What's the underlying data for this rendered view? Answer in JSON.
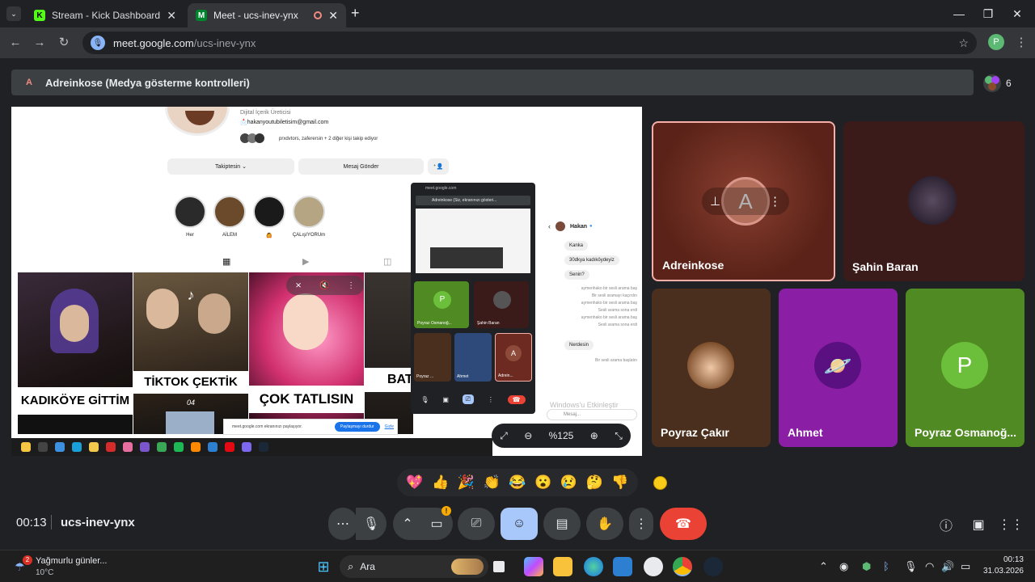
{
  "browser": {
    "tabs": [
      {
        "title": "Stream - Kick Dashboard",
        "favicon": "K",
        "favicon_color": "#53fc18"
      },
      {
        "title": "Meet - ucs-inev-ynx",
        "favicon": "M",
        "favicon_color": "#00832d"
      }
    ],
    "new_tab": "+",
    "url_host": "meet.google.com",
    "url_path": "/ucs-inev-ynx",
    "profile_initial": "P"
  },
  "meet": {
    "presenting_avatar": "A",
    "presenting_label": "Adreinkose (Medya gösterme kontrolleri)",
    "participant_count": "6",
    "time": "00:13",
    "meeting_code": "ucs-inev-ynx",
    "tiles": [
      {
        "name": "Adreinkose",
        "initial": "A",
        "color": "#6d2a20"
      },
      {
        "name": "Şahin Baran",
        "color": "#3b1a1a"
      },
      {
        "name": "Poyraz Çakır",
        "color": "#4a2f1e"
      },
      {
        "name": "Ahmet",
        "color": "#8a1fa6"
      },
      {
        "name": "Poyraz Osmanoğ...",
        "initial": "P",
        "color": "#4f8a22"
      }
    ],
    "reactions": [
      "💖",
      "👍",
      "🎉",
      "👏",
      "😂",
      "😮",
      "😢",
      "🤔",
      "👎"
    ],
    "reaction_skin_tone": "#f9cc19",
    "end_call_color": "#ea4335",
    "active_control_color": "#a8c7fa"
  },
  "shared_screen": {
    "profile_role": "Dijital İçerik Üreticisi",
    "profile_email": "📩hakanyoutubiletisim@gmail.com",
    "followed_by": "prxdvtors, zaferersin + 2 diğer kişi takip ediyor",
    "follow_btn": "Takiptesin ⌄",
    "message_btn": "Mesaj Gönder",
    "highlights": [
      "Her",
      "AİLEM",
      "🙆",
      "ÇALışIYORUm"
    ],
    "post_captions": [
      "KADIKÖYE GİTTİM",
      "TİKTOK ÇEKTİK",
      "ÇOK TATLISIN",
      "BAT"
    ],
    "post_sub": "04",
    "chat_name": "Hakan",
    "chat_messages": [
      "Kanka",
      "30dkya kadıköydeyiz",
      "Senin?"
    ],
    "chat_system": [
      "aymenhako bir sesli arama baş",
      "Bir sesli aramayı kaçırdın",
      "aymenhako bir sesli arama baş",
      "Sesli arama sona erdi",
      "aymenhako bir sesli arama baş",
      "Sesli arama sona erdi"
    ],
    "chat_last": "Nerdesin",
    "chat_last_sys": "Bir sesli arama başlatın",
    "chat_input": "Mesaj...",
    "watermark": "Windows'u Etkinleştir",
    "mini_url": "meet.google.com",
    "mini_banner": "Adreinkose (Siz, ekranınızı gösteri...",
    "mini_tiles": [
      "Poyraz Osmanoğ...",
      "Şahin Baran",
      "Poyraz ...",
      "Ahmet",
      "Adrein..."
    ],
    "share_text": "meet.google.com ekranınızı paylaşıyor.",
    "share_stop": "Paylaşmayı durdur",
    "share_hide": "Gizle",
    "zoom": "%125"
  },
  "taskbar": {
    "weather_temp_badge": "2",
    "weather_title": "Yağmurlu günler...",
    "weather_temp": "10°C",
    "search": "Ara",
    "clock_time": "00:13",
    "clock_date": "31.03.2026"
  }
}
